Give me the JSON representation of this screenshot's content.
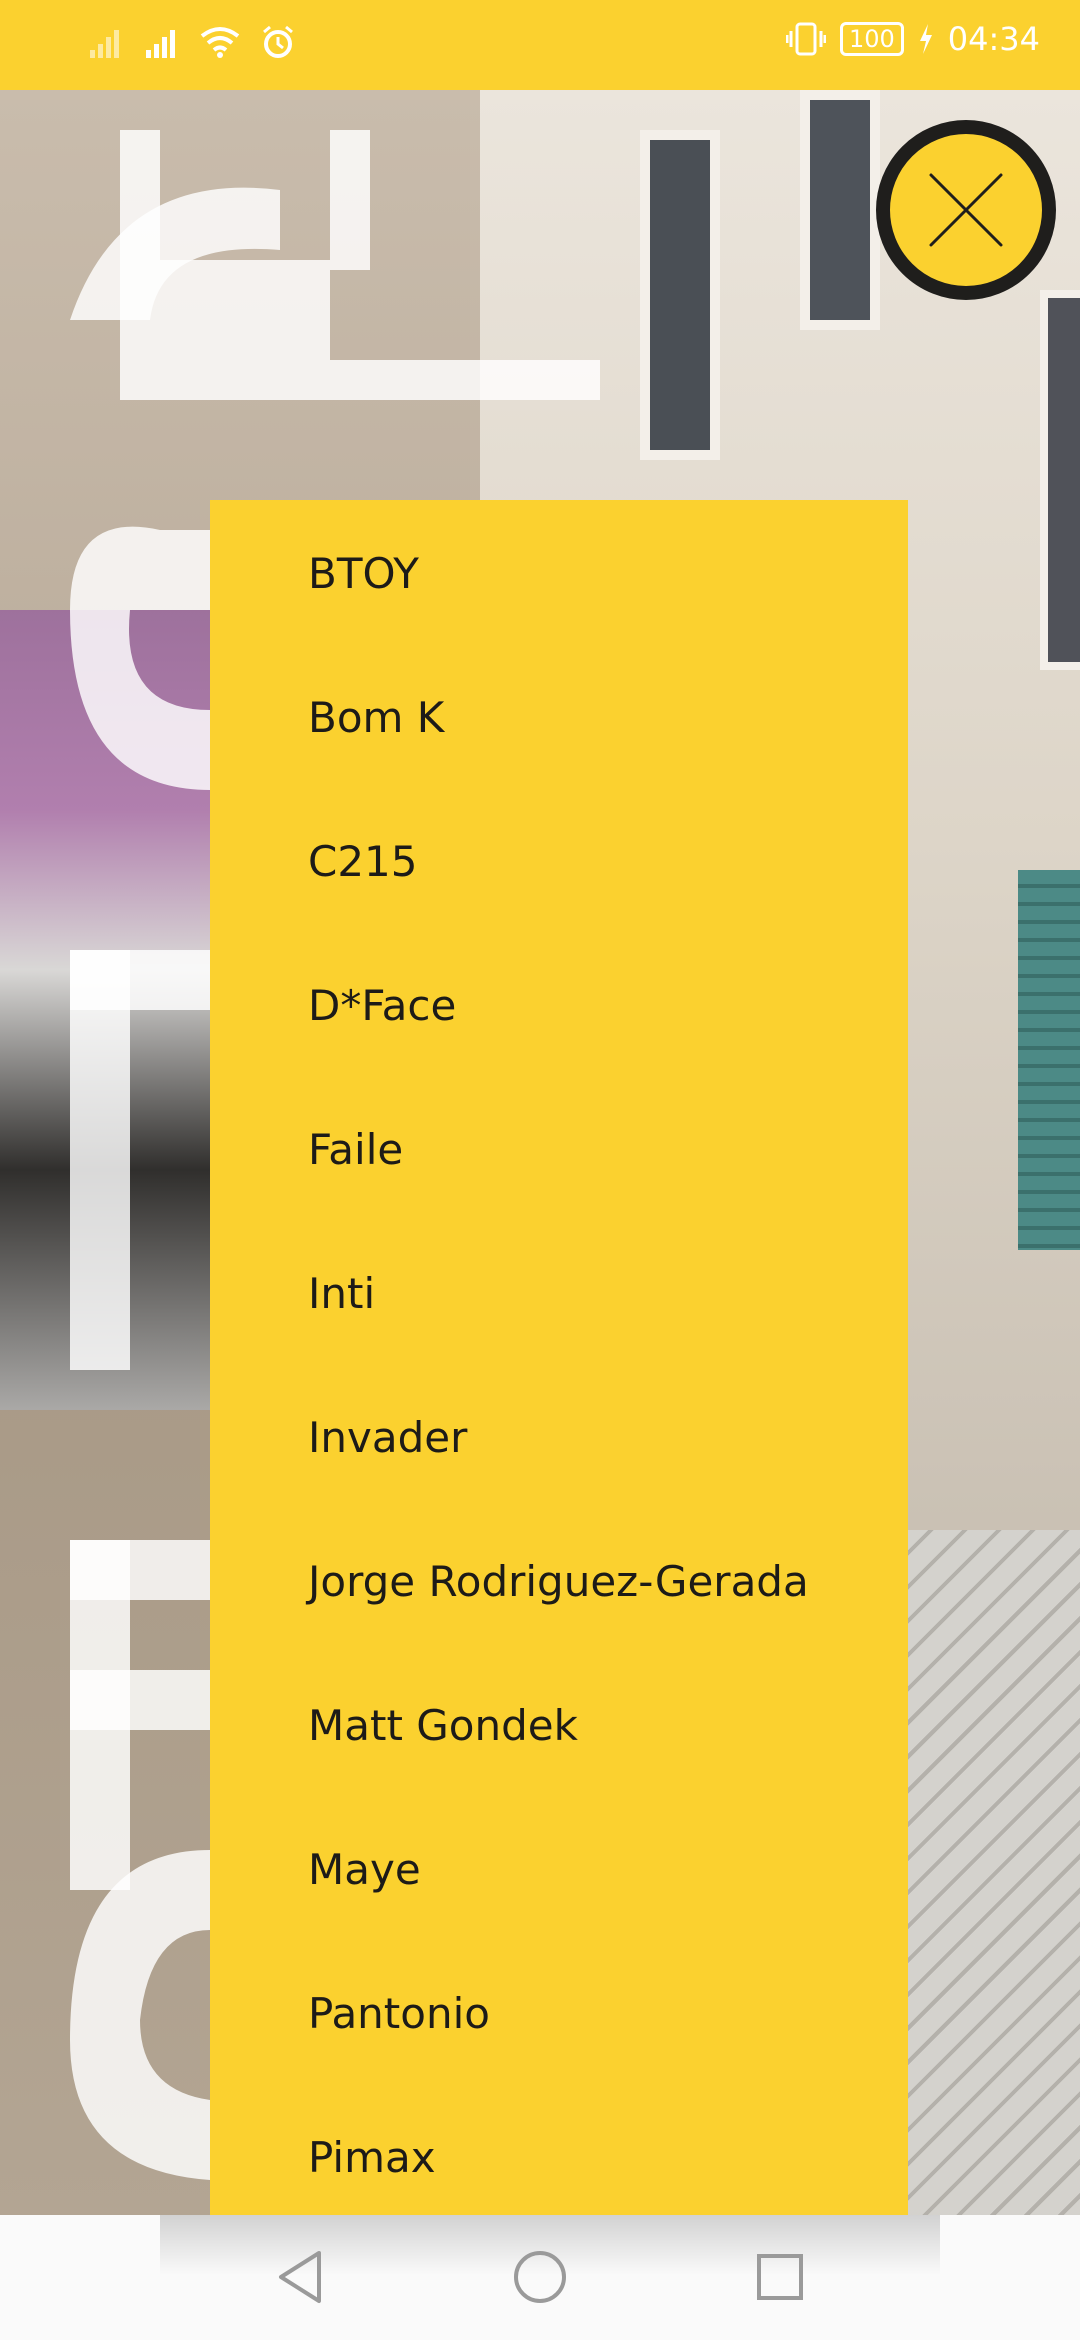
{
  "status_bar": {
    "time": "04:34",
    "battery": "100",
    "icons": [
      "signal-icon",
      "signal-icon",
      "wifi-icon",
      "alarm-icon",
      "vibrate-icon",
      "battery-icon",
      "charging-icon"
    ]
  },
  "background": {
    "description_colors": {
      "accent": "#fbd12f",
      "dark": "#1d1b18"
    }
  },
  "close_button": {
    "icon": "close-icon"
  },
  "menu": {
    "items": [
      "BTOY",
      "Bom K",
      "C215",
      "D*Face",
      "Faile",
      "Inti",
      "Invader",
      "Jorge Rodriguez-Gerada",
      "Matt Gondek",
      "Maye",
      "Pantonio",
      "Pimax"
    ]
  },
  "nav_bar": {
    "buttons": [
      "back-icon",
      "home-icon",
      "recents-icon"
    ]
  }
}
